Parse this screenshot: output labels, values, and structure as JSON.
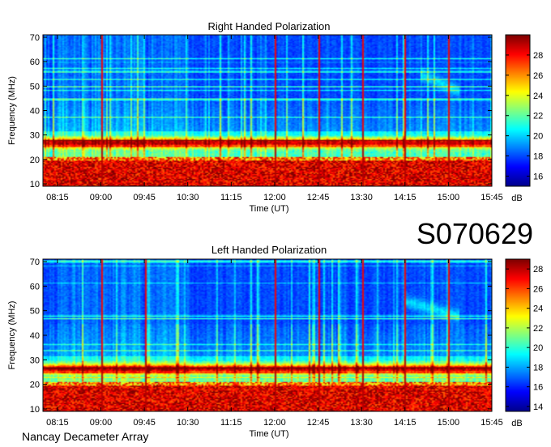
{
  "figure": {
    "observation_code": "S070629",
    "footer": "Nancay Decameter Array"
  },
  "colors": {
    "ramp": [
      "#00008f",
      "#0000ff",
      "#0080ff",
      "#00ffff",
      "#80ff80",
      "#ffff00",
      "#ff8000",
      "#ff0000",
      "#800000"
    ]
  },
  "chart_data": [
    {
      "type": "heatmap",
      "title": "Right Handed Polarization",
      "xlabel": "Time (UT)",
      "ylabel": "Frequency (MHz)",
      "x_ticks": [
        "08:15",
        "09:00",
        "09:45",
        "10:30",
        "11:15",
        "12:00",
        "12:45",
        "13:30",
        "14:15",
        "15:00",
        "15:45"
      ],
      "y_ticks": [
        10,
        20,
        30,
        40,
        50,
        60,
        70
      ],
      "xlim": [
        "08:00",
        "15:45"
      ],
      "ylim": [
        9,
        71
      ],
      "colorbar_label": "dB",
      "colorbar_ticks": [
        16,
        18,
        20,
        22,
        24,
        26,
        28
      ],
      "colorbar_range": [
        15,
        30
      ],
      "vertical_lines_ut": [
        "09:00",
        "12:00",
        "12:45",
        "13:30",
        "14:15",
        "15:00"
      ],
      "features": {
        "low_band_saturation_mhz": [
          10,
          20
        ],
        "strong_band_mhz": 27,
        "burst_arc": {
          "start_ut": "14:30",
          "end_ut": "15:10",
          "freq_start_mhz": 55,
          "freq_end_mhz": 48
        }
      }
    },
    {
      "type": "heatmap",
      "title": "Left Handed Polarization",
      "xlabel": "Time (UT)",
      "ylabel": "Frequency (MHz)",
      "x_ticks": [
        "08:15",
        "09:00",
        "09:45",
        "10:30",
        "11:15",
        "12:00",
        "12:45",
        "13:30",
        "14:15",
        "15:00",
        "15:45"
      ],
      "y_ticks": [
        10,
        20,
        30,
        40,
        50,
        60,
        70
      ],
      "xlim": [
        "08:00",
        "15:45"
      ],
      "ylim": [
        9,
        71
      ],
      "colorbar_label": "dB",
      "colorbar_ticks": [
        14,
        16,
        18,
        20,
        22,
        24,
        26,
        28
      ],
      "colorbar_range": [
        13.5,
        29
      ],
      "vertical_lines_ut": [
        "09:00",
        "09:45",
        "12:00",
        "12:45",
        "13:30",
        "14:15",
        "15:00"
      ],
      "features": {
        "low_band_saturation_mhz": [
          10,
          20
        ],
        "strong_band_mhz": 26.5,
        "burst_arc": {
          "start_ut": "14:15",
          "end_ut": "15:10",
          "freq_start_mhz": 54,
          "freq_end_mhz": 48
        }
      }
    }
  ]
}
